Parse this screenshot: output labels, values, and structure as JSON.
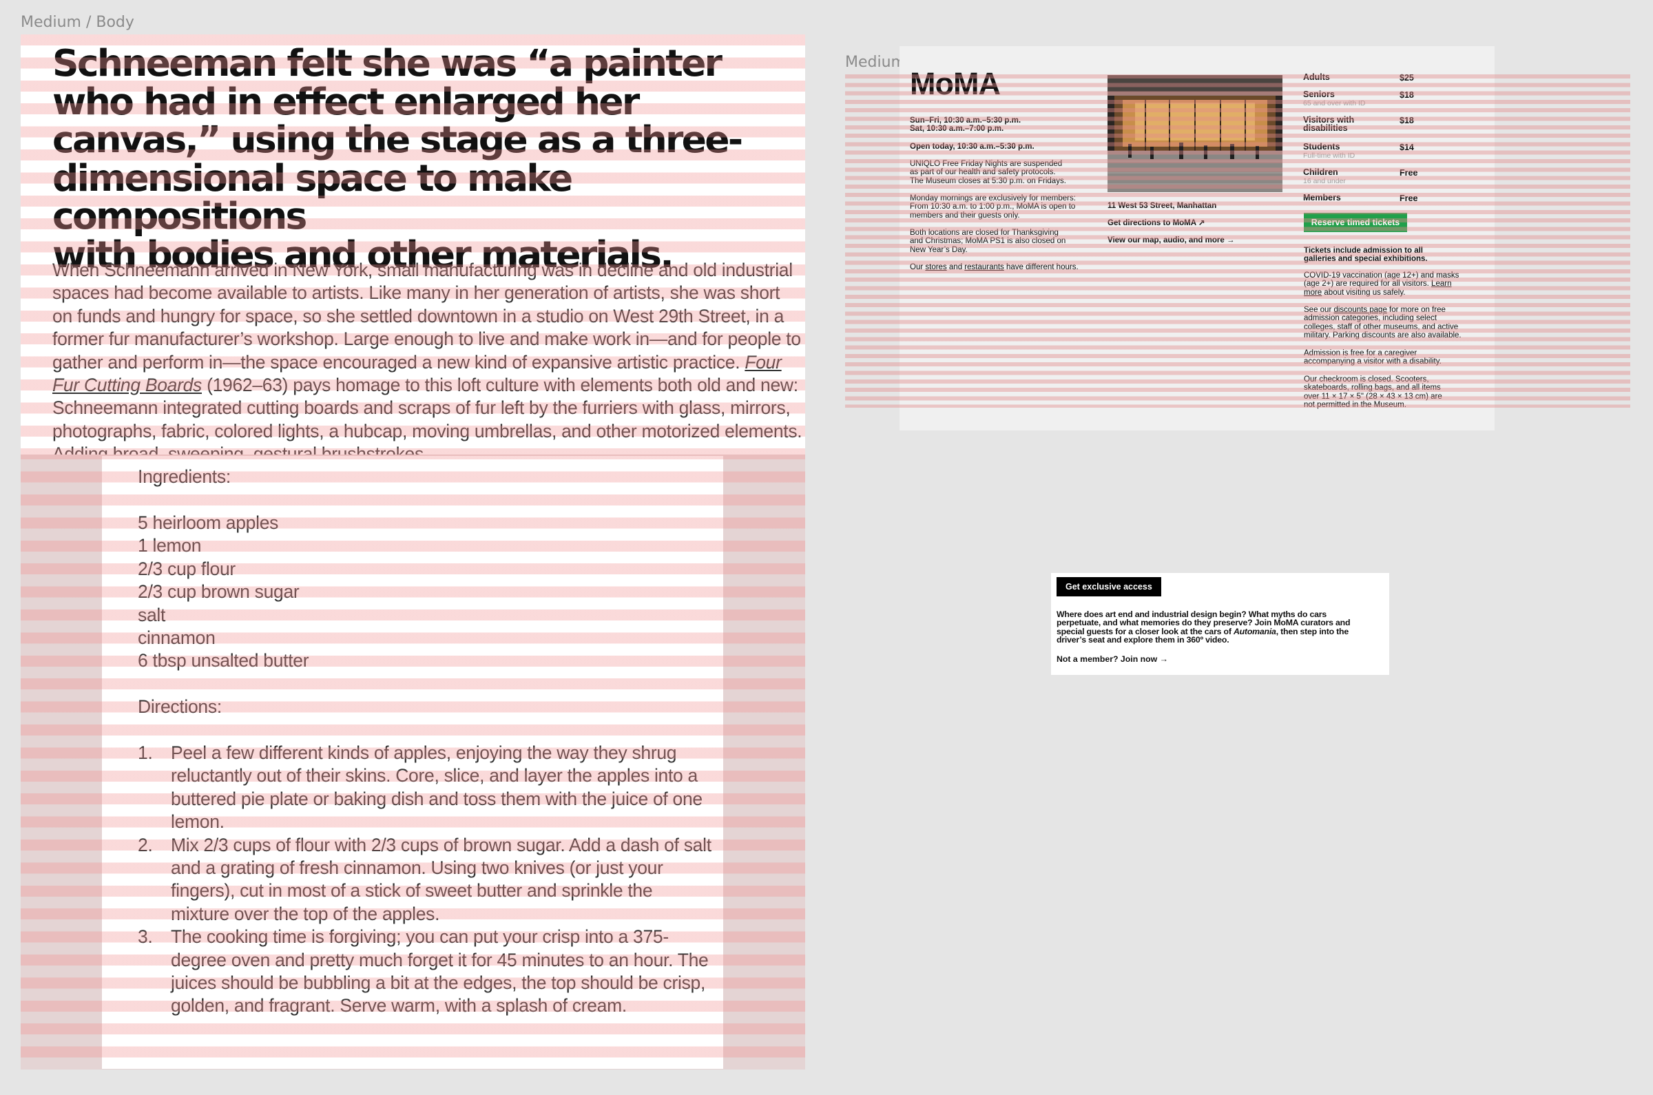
{
  "frames": {
    "body_label": "Medium / Body",
    "solid_label": "Medium / Solid"
  },
  "article": {
    "headline": "Schneeman felt she was “a painter\nwho had in effect enlarged her\ncanvas,” using the stage as a three-\ndimensional space to make compositions\nwith bodies and other materials.",
    "paragraph_before": "When Schneemann arrived in New York, small manufacturing was in decline and old industrial spaces had become available to artists. Like many in her generation of artists, she was short on funds and hungry for space, so she settled downtown in a studio on West 29th Street, in a former fur manufacturer’s workshop. Large enough to live and make work in—and for people to gather and perform in—the space encouraged a new kind of expansive artistic practice. ",
    "paragraph_link": "Four Fur Cutting Boards",
    "paragraph_after": " (1962–63) pays homage to this loft culture with elements both old and new: Schneemann integrated cutting boards and scraps of fur left by the furriers with glass, mirrors, photographs, fabric, colored lights, a hubcap, moving umbrellas, and other motorized elements. Adding broad, sweeping, gestural brushstrokes"
  },
  "recipe": {
    "ingredients_heading": "Ingredients:",
    "ingredients": [
      "5 heirloom apples",
      "1 lemon",
      "2/3 cup flour",
      "2/3 cup brown sugar",
      "salt",
      "cinnamon",
      "6 tbsp unsalted butter"
    ],
    "directions_heading": "Directions:",
    "steps": [
      {
        "num": "1.",
        "text": "Peel a few different kinds of apples, enjoying the way they shrug reluctantly out of their skins. Core, slice, and layer the apples into a buttered pie plate or baking dish and toss them with the juice of one lemon."
      },
      {
        "num": "2.",
        "text": "Mix 2/3 cups of flour with 2/3 cups of brown sugar. Add a dash of salt and a grating of fresh cinnamon. Using two knives (or just your fingers), cut in most of a stick of sweet butter and sprinkle the mixture over the top of the apples."
      },
      {
        "num": "3.",
        "text": "The cooking time is forgiving; you can put your crisp into a 375-degree oven and pretty much forget it for 45 minutes to an hour. The juices should be bubbling a bit at the edges, the top should be crisp, golden, and fragrant. Serve warm, with a splash of cream."
      }
    ]
  },
  "moma": {
    "logo": "MoMA",
    "hours_1": "Sun–Fri, 10:30 a.m.–5:30 p.m.",
    "hours_2": "Sat, 10:30 a.m.–7:00 p.m.",
    "open_today": "Open today, 10:30 a.m.–5:30 p.m.",
    "uniqlo_note": "UNIQLO Free Friday Nights are suspended as part of our health and safety protocols. The Museum closes at 5:30 p.m. on Fridays.",
    "monday_note": "Monday mornings are exclusively for members: From 10:30 a.m. to 1:00 p.m., MoMA is open to members and their guests only.",
    "closed_note": "Both locations are closed for Thanksgiving and Christmas; MoMA PS1 is also closed on New Year’s Day.",
    "stores_prefix": "Our ",
    "stores_link": "stores",
    "stores_and": " and ",
    "restaurants_link": "restaurants",
    "stores_suffix": " have different hours.",
    "address": "11 West 53 Street, Manhattan",
    "directions_link": "Get directions to MoMA ↗",
    "map_link": "View our map, audio, and more →",
    "prices": [
      {
        "category": "Adults",
        "note": "",
        "price": "$25"
      },
      {
        "category": "Seniors",
        "note": "65 and over with ID",
        "price": "$18"
      },
      {
        "category": "Visitors with disabilities",
        "note": "",
        "price": "$18"
      },
      {
        "category": "Students",
        "note": "Full-time with ID",
        "price": "$14"
      },
      {
        "category": "Children",
        "note": "16 and under",
        "price": "Free"
      },
      {
        "category": "Members",
        "note": "",
        "price": "Free"
      }
    ],
    "reserve_button": "Reserve timed tickets",
    "tickets_include": "Tickets include admission to all galleries and special exhibitions.",
    "covid_text": "COVID-19 vaccination (age 12+) and masks (age 2+) are required for all visitors. ",
    "learn_more": "Learn more",
    "covid_suffix": " about visiting us safely.",
    "discounts_prefix": "See our ",
    "discounts_link": "discounts page",
    "discounts_suffix": " for more on free admission categories, including select colleges, staff of other museums, and active military. Parking discounts are also available.",
    "caregiver_note": "Admission is free for a caregiver accompanying a visitor with a disability.",
    "checkroom_note": "Our checkroom is closed. Scooters, skateboards, rolling bags, and all items over 11 × 17 × 5\" (28 × 43 × 13 cm) are not permitted in the Museum."
  },
  "access": {
    "badge": "Get exclusive access",
    "body_1": "Where does art end and industrial design begin? What myths do cars perpetuate, and what memories do they preserve? Join MoMA curators and special guests for a closer look at the cars of ",
    "body_em": "Automania",
    "body_2": ", then step into the driver’s seat and explore them in 360º video.",
    "link": "Not a member? Join now →"
  },
  "colors": {
    "background": "#e5e5e5",
    "grid_stripe": "#f29191",
    "reserve_green": "#21a04b",
    "badge_black": "#000000"
  }
}
